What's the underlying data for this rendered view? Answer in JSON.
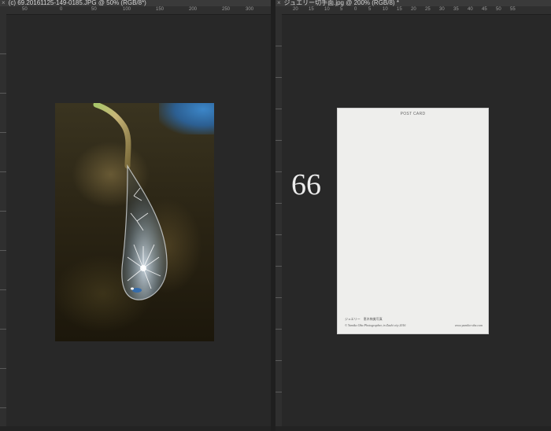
{
  "left_document": {
    "tab_close": "×",
    "tab_title": "(c) 69.20161125-149-0185.JPG @ 50% (RGB/8*)",
    "ruler_labels": [
      "50",
      "0",
      "50",
      "100",
      "150",
      "200",
      "250",
      "300"
    ]
  },
  "right_document": {
    "tab_close": "×",
    "tab_title": "ジュエリー切手面.jpg @ 200% (RGB/8) *",
    "ruler_labels": [
      "20",
      "15",
      "10",
      "5",
      "0",
      "5",
      "10",
      "15",
      "20",
      "25",
      "30",
      "35",
      "40",
      "45",
      "50",
      "55"
    ]
  },
  "overlay": {
    "page_number": "66"
  },
  "postcard": {
    "title": "POST CARD",
    "credit_line": "ジュエリー　恵木絢美写真",
    "copyright_line": "© Yumiko Oba Photographer, in Zushi city 2016",
    "website": "www.yumiko-oba.com"
  },
  "colors": {
    "workspace_bg": "#282828",
    "tab_bg": "#3a3a3a",
    "ruler_bg": "#2f2f2f",
    "sky_blue": "#2c5f92"
  }
}
